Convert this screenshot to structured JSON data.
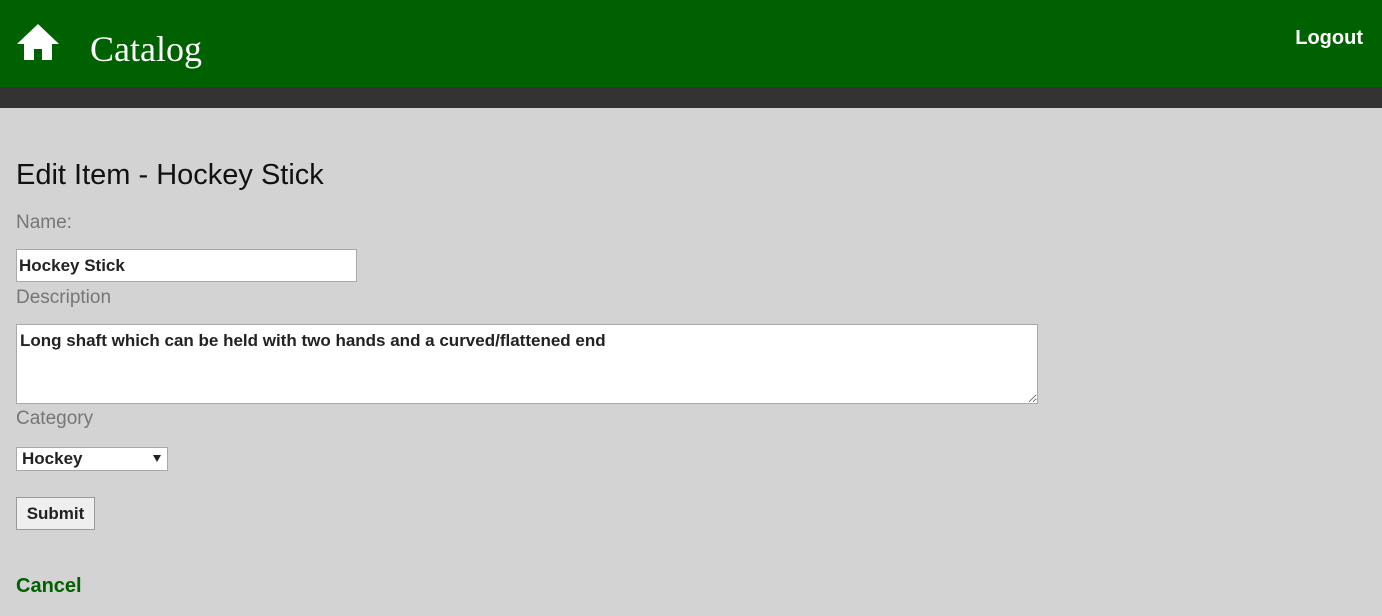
{
  "header": {
    "home_icon": "home-icon",
    "brand": "Catalog",
    "logout_label": "Logout",
    "background_color": "#006100",
    "subbar_color": "#333333"
  },
  "form": {
    "title": "Edit Item - Hockey Stick",
    "name_label": "Name:",
    "name_value": "Hockey Stick",
    "description_label": "Description",
    "description_value": "Long shaft which can be held with two hands and a curved/flattened end",
    "category_label": "Category",
    "category_selected": "Hockey",
    "submit_label": "Submit",
    "cancel_label": "Cancel"
  }
}
